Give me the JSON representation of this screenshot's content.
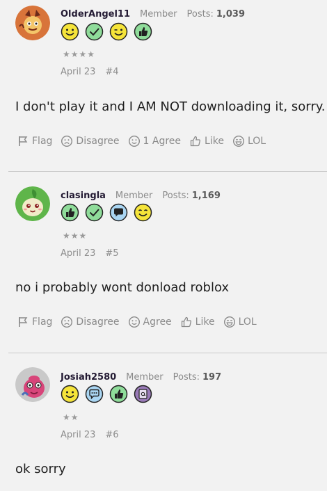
{
  "posts": [
    {
      "username": "OlderAngel11",
      "role": "Member",
      "posts_label": "Posts:",
      "posts_count": "1,039",
      "stars": "★★★★",
      "date": "April 23",
      "post_number": "#4",
      "message": "I don't play it and I AM NOT downloading it, sorry.",
      "trophies": [
        "smile-trophy-icon",
        "check-trophy-icon",
        "wink-trophy-icon",
        "thumbs-up-trophy-icon"
      ],
      "actions": {
        "flag": "Flag",
        "disagree": "Disagree",
        "agree": "1 Agree",
        "like": "Like",
        "lol": "LOL"
      }
    },
    {
      "username": "clasingla",
      "role": "Member",
      "posts_label": "Posts:",
      "posts_count": "1,169",
      "stars": "★★★",
      "date": "April 23",
      "post_number": "#5",
      "message": "no i probably wont donload roblox",
      "trophies": [
        "thumbs-up-trophy-icon",
        "check-trophy-icon",
        "speech-trophy-icon",
        "wink-trophy-icon"
      ],
      "actions": {
        "flag": "Flag",
        "disagree": "Disagree",
        "agree": "Agree",
        "like": "Like",
        "lol": "LOL"
      }
    },
    {
      "username": "Josiah2580",
      "role": "Member",
      "posts_label": "Posts:",
      "posts_count": "197",
      "stars": "★★",
      "date": "April 23",
      "post_number": "#6",
      "message": "ok sorry",
      "trophies": [
        "smile-trophy-icon",
        "speech-trophy-icon",
        "thumbs-up-trophy-icon",
        "at-sign-trophy-icon"
      ]
    }
  ],
  "colors": {
    "trophy_yellow": "#f5e43a",
    "trophy_green": "#8fdc9a",
    "trophy_blue": "#a9d5f2",
    "trophy_purple": "#9a7bb8",
    "text_muted": "#8a8a8a",
    "username": "#231a33"
  }
}
